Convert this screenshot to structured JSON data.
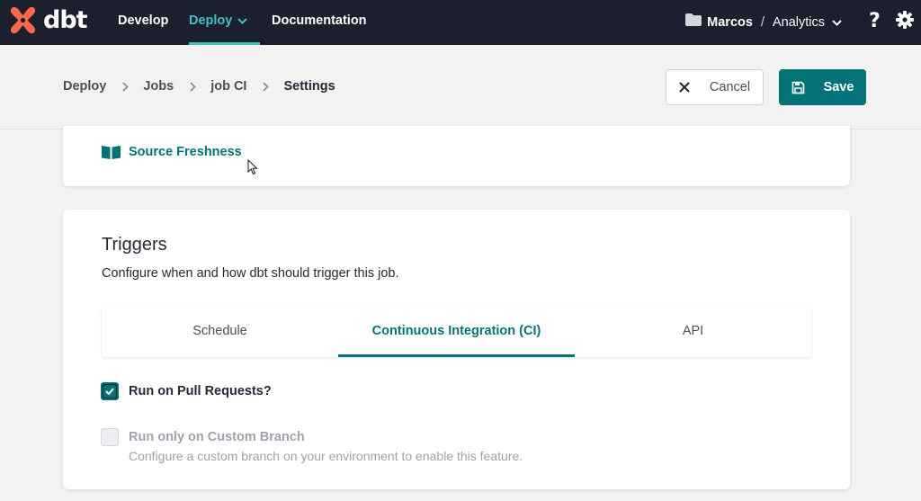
{
  "brand": {
    "logo_text": "dbt",
    "accent": "#3ec1c0",
    "primary": "#047377"
  },
  "nav": {
    "items": [
      {
        "label": "Develop"
      },
      {
        "label": "Deploy"
      },
      {
        "label": "Documentation"
      }
    ],
    "account": {
      "user": "Marcos",
      "separator": "/",
      "project": "Analytics"
    },
    "icons": {
      "help": "help-icon",
      "settings": "gear-icon"
    }
  },
  "breadcrumb": [
    {
      "label": "Deploy"
    },
    {
      "label": "Jobs"
    },
    {
      "label": "job CI"
    },
    {
      "label": "Settings"
    }
  ],
  "actions": {
    "cancel_label": "Cancel",
    "save_label": "Save"
  },
  "source_freshness": {
    "label": "Source Freshness"
  },
  "triggers": {
    "title": "Triggers",
    "description": "Configure when and how dbt should trigger this job.",
    "tabs": [
      {
        "label": "Schedule"
      },
      {
        "label": "Continuous Integration (CI)"
      },
      {
        "label": "API"
      }
    ],
    "active_tab": "Continuous Integration (CI)",
    "options": [
      {
        "label": "Run on Pull Requests?",
        "checked": true,
        "disabled": false
      },
      {
        "label": "Run only on Custom Branch",
        "checked": false,
        "disabled": true,
        "help": "Configure a custom branch on your environment to enable this feature."
      }
    ]
  }
}
